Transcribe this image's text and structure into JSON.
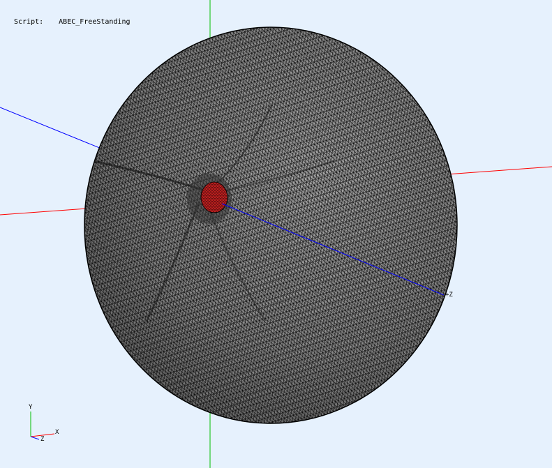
{
  "viewport": {
    "background": "#e6f1fd",
    "script_label": "Script:",
    "script_name": "ABEC_FreeStanding"
  },
  "axes": {
    "x_color": "#ff0000",
    "y_color": "#00c000",
    "z_color": "#0000ff",
    "z_label": "+Z"
  },
  "mesh": {
    "fill_color": "#8a8a8a",
    "wire_color": "#000000",
    "driver_color": "#c42020"
  },
  "triad": {
    "x_label": "X",
    "y_label": "Y",
    "z_label": "Z"
  }
}
